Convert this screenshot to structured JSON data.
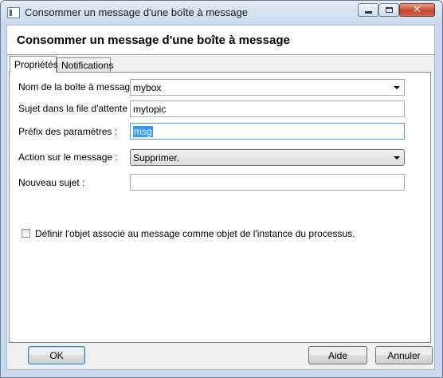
{
  "window": {
    "title": "Consommer un message d'une boîte à message",
    "controls": {
      "close_glyph": "✕"
    }
  },
  "header": {
    "title": "Consommer un message d'une boîte à message"
  },
  "tabs": [
    {
      "label": "Propriétés",
      "active": true
    },
    {
      "label": "Notifications",
      "active": false
    }
  ],
  "form": {
    "mailbox": {
      "label": "Nom de la boîte à message :",
      "value": "mybox"
    },
    "queue_subject": {
      "label": "Sujet dans la file d'attente :",
      "value": "mytopic"
    },
    "param_prefix": {
      "label": "Préfix des paramètres :",
      "value": "msg"
    },
    "action": {
      "label": "Action sur le message :",
      "value": "Supprimer."
    },
    "new_subject": {
      "label": "Nouveau sujet :",
      "value": ""
    },
    "checkbox": {
      "label": "Définir l'objet associé au message comme objet de l'instance du processus.",
      "checked": false
    }
  },
  "buttons": {
    "ok": "OK",
    "help": "Aide",
    "cancel": "Annuler"
  }
}
